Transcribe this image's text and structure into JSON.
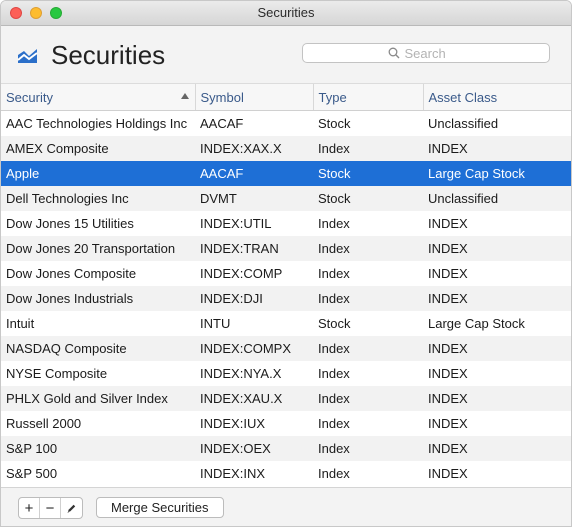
{
  "window": {
    "title": "Securities"
  },
  "header": {
    "icon": "chart-icon",
    "title": "Securities",
    "search_placeholder": "Search"
  },
  "table": {
    "columns": [
      "Security",
      "Symbol",
      "Type",
      "Asset Class"
    ],
    "sort_column": "Security",
    "sort_direction": "ascending",
    "selected_row": "Apple",
    "rows": [
      {
        "security": "AAC Technologies Holdings Inc",
        "symbol": "AACAF",
        "type": "Stock",
        "asset_class": "Unclassified"
      },
      {
        "security": "AMEX Composite",
        "symbol": "INDEX:XAX.X",
        "type": "Index",
        "asset_class": "INDEX"
      },
      {
        "security": "Apple",
        "symbol": "AACAF",
        "type": "Stock",
        "asset_class": "Large Cap Stock"
      },
      {
        "security": "Dell Technologies Inc",
        "symbol": "DVMT",
        "type": "Stock",
        "asset_class": "Unclassified"
      },
      {
        "security": "Dow Jones 15 Utilities",
        "symbol": "INDEX:UTIL",
        "type": "Index",
        "asset_class": "INDEX"
      },
      {
        "security": "Dow Jones 20 Transportation",
        "symbol": "INDEX:TRAN",
        "type": "Index",
        "asset_class": "INDEX"
      },
      {
        "security": "Dow Jones Composite",
        "symbol": "INDEX:COMP",
        "type": "Index",
        "asset_class": "INDEX"
      },
      {
        "security": "Dow Jones Industrials",
        "symbol": "INDEX:DJI",
        "type": "Index",
        "asset_class": "INDEX"
      },
      {
        "security": "Intuit",
        "symbol": "INTU",
        "type": "Stock",
        "asset_class": "Large Cap Stock"
      },
      {
        "security": "NASDAQ Composite",
        "symbol": "INDEX:COMPX",
        "type": "Index",
        "asset_class": "INDEX"
      },
      {
        "security": "NYSE Composite",
        "symbol": "INDEX:NYA.X",
        "type": "Index",
        "asset_class": "INDEX"
      },
      {
        "security": "PHLX Gold and Silver Index",
        "symbol": "INDEX:XAU.X",
        "type": "Index",
        "asset_class": "INDEX"
      },
      {
        "security": "Russell 2000",
        "symbol": "INDEX:IUX",
        "type": "Index",
        "asset_class": "INDEX"
      },
      {
        "security": "S&P 100",
        "symbol": "INDEX:OEX",
        "type": "Index",
        "asset_class": "INDEX"
      },
      {
        "security": "S&P 500",
        "symbol": "INDEX:INX",
        "type": "Index",
        "asset_class": "INDEX"
      }
    ]
  },
  "footer": {
    "add_label": "+",
    "remove_label": "−",
    "edit_icon": "pencil-icon",
    "merge_label": "Merge Securities"
  },
  "colors": {
    "selection": "#1e6fd6",
    "header_text": "#3a5a8a",
    "icon_blue": "#2b6fc9"
  }
}
